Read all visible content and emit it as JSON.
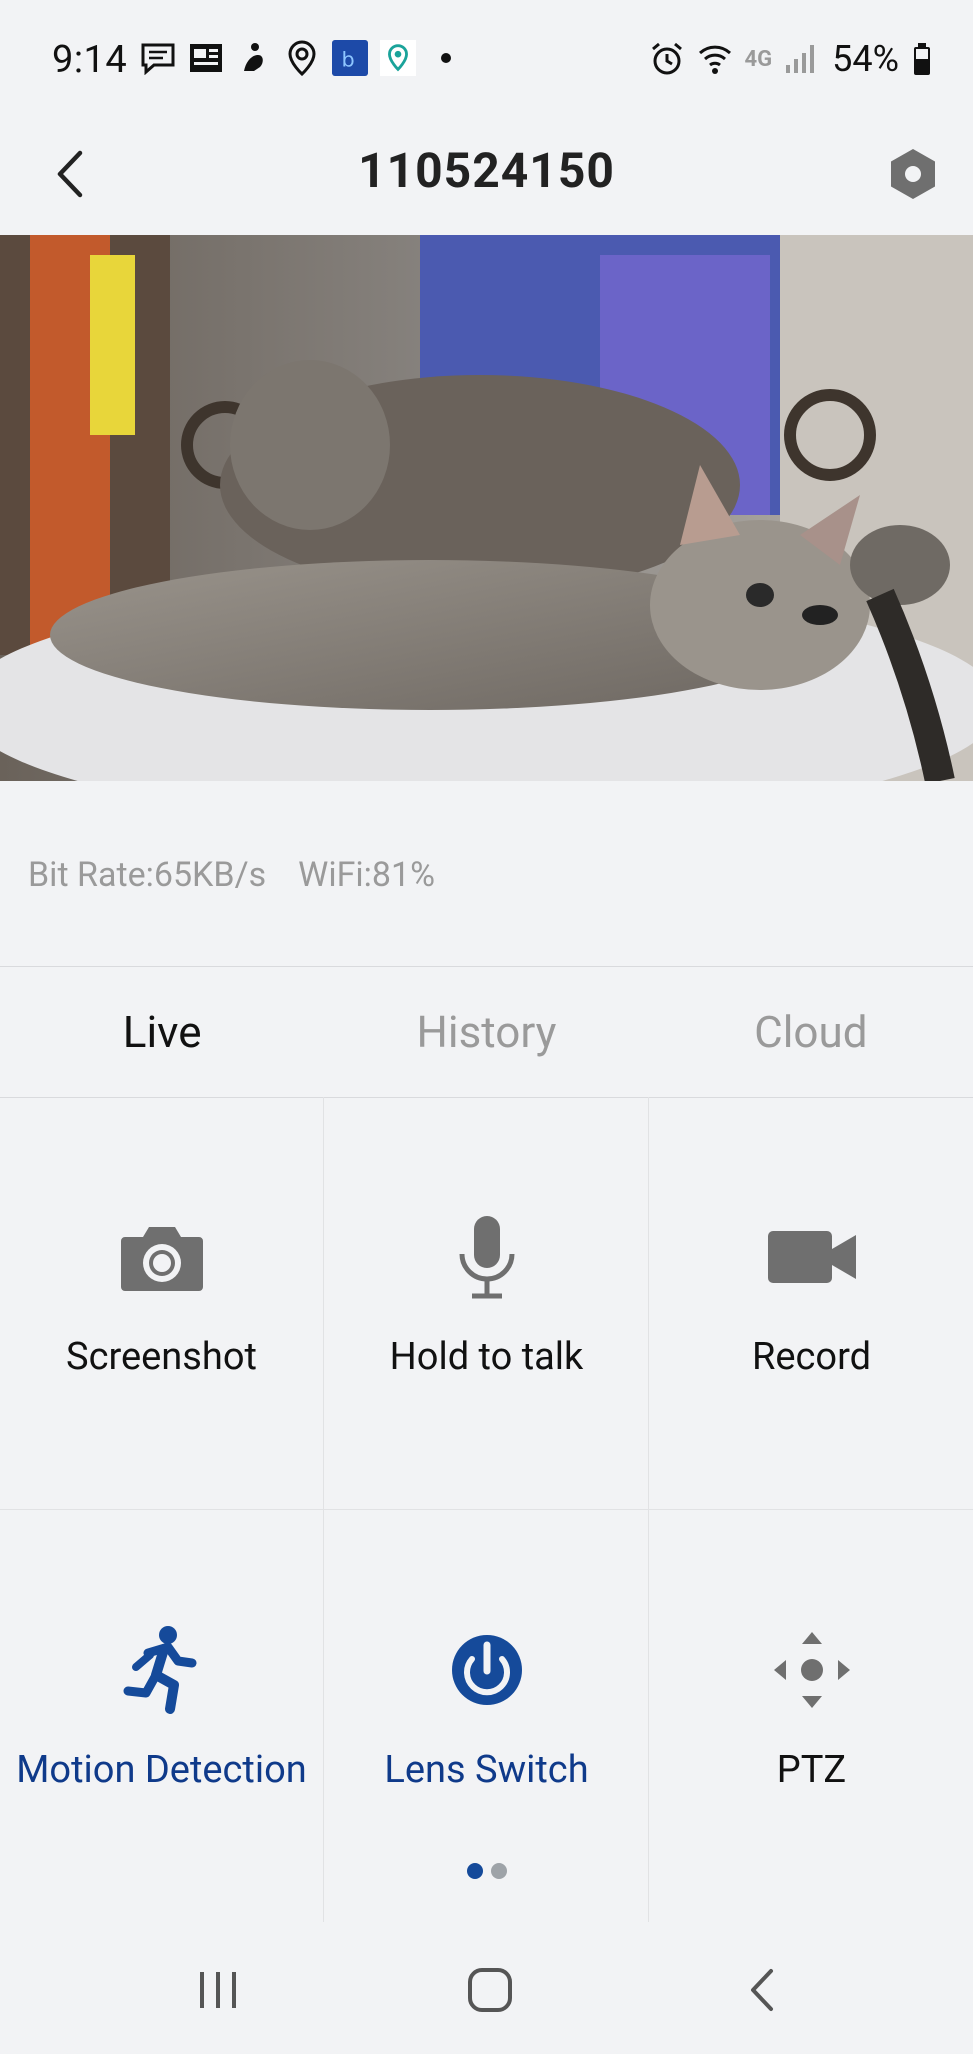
{
  "status_bar": {
    "time": "9:14",
    "network_label": "4G",
    "battery": "54%"
  },
  "header": {
    "title": "110524150"
  },
  "stats": {
    "bit_rate": "Bit Rate:65KB/s",
    "wifi": "WiFi:81%"
  },
  "tabs": [
    {
      "label": "Live",
      "active": true
    },
    {
      "label": "History",
      "active": false
    },
    {
      "label": "Cloud",
      "active": false
    }
  ],
  "controls": [
    {
      "label": "Screenshot",
      "icon": "camera-icon"
    },
    {
      "label": "Hold to talk",
      "icon": "microphone-icon"
    },
    {
      "label": "Record",
      "icon": "video-camera-icon"
    },
    {
      "label": "Motion Detection",
      "icon": "running-person-icon",
      "active": true
    },
    {
      "label": "Lens Switch",
      "icon": "power-icon",
      "active": true
    },
    {
      "label": "PTZ",
      "icon": "directional-pad-icon"
    }
  ],
  "pager": {
    "pages": 2,
    "current": 0
  },
  "colors": {
    "accent": "#154a9a",
    "accent_text": "#0f3a8a",
    "icon_gray": "#6f6f6f",
    "background": "#f2f3f5"
  }
}
